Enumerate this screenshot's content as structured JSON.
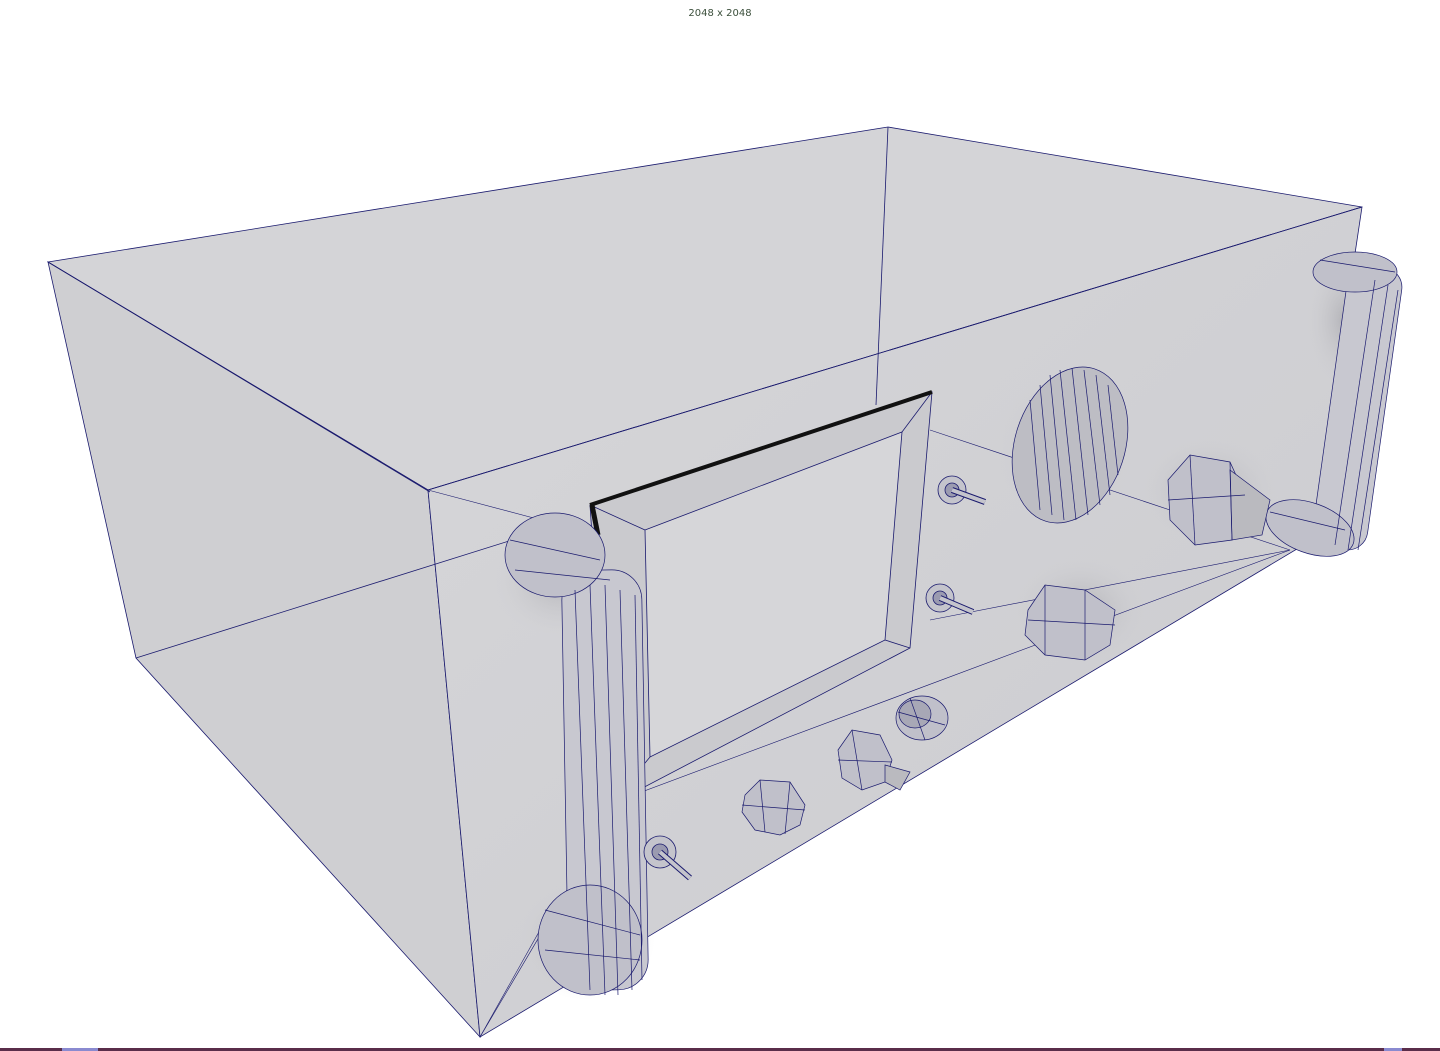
{
  "viewport": {
    "resolution_label": "2048 x 2048"
  },
  "colors": {
    "background": "#ffffff",
    "body_fill": "#d2d2d5",
    "wire": "#1a1a6e",
    "label": "#3b4f3b",
    "status_bar": "#5a2d4a"
  }
}
